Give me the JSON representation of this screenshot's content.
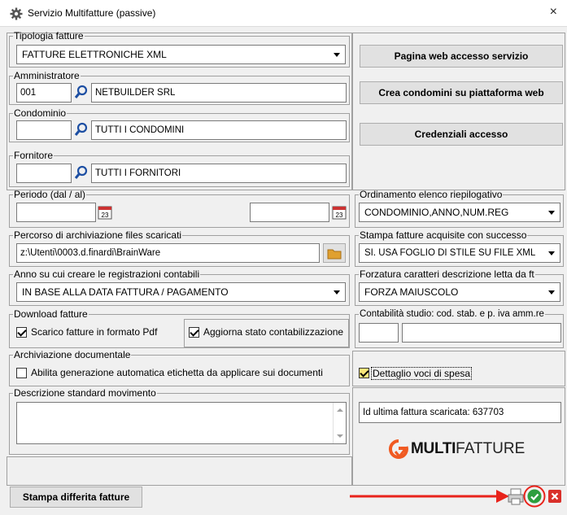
{
  "window": {
    "title": "Servizio Multifatture (passive)",
    "close": "×"
  },
  "tipologia": {
    "legend": "Tipologia fatture",
    "value": "FATTURE ELETTRONICHE XML"
  },
  "amministratore": {
    "legend": "Amministratore",
    "code": "001",
    "name": "NETBUILDER SRL"
  },
  "condominio": {
    "legend": "Condominio",
    "code": "",
    "name": "TUTTI I CONDOMINI"
  },
  "fornitore": {
    "legend": "Fornitore",
    "code": "",
    "name": "TUTTI I FORNITORI"
  },
  "buttons": {
    "pagina_web": "Pagina web accesso servizio",
    "crea_condomini": "Crea condomini su piattaforma web",
    "credenziali": "Credenziali accesso",
    "stampa_differita": "Stampa differita fatture"
  },
  "periodo": {
    "legend": "Periodo (dal / al)",
    "from": "",
    "to": "",
    "cal_label": "23"
  },
  "ordinamento": {
    "legend": "Ordinamento elenco riepilogativo",
    "value": "CONDOMINIO,ANNO,NUM.REG"
  },
  "percorso": {
    "legend": "Percorso di archiviazione files scaricati",
    "value": "z:\\Utenti\\0003.d.finardi\\BrainWare"
  },
  "stampa_fatture": {
    "legend": "Stampa fatture acquisite con successo",
    "value": "SI. USA FOGLIO DI STILE SU FILE XML"
  },
  "anno": {
    "legend": "Anno su cui creare le registrazioni contabili",
    "value": "IN BASE ALLA DATA FATTURA / PAGAMENTO"
  },
  "forzatura": {
    "legend": "Forzatura caratteri descrizione letta da ft",
    "value": "FORZA MAIUSCOLO"
  },
  "download": {
    "legend": "Download fatture",
    "pdf": "Scarico fatture in formato Pdf",
    "pdf_checked": true,
    "aggiorna": "Aggiorna stato contabilizzazione",
    "aggiorna_checked": true
  },
  "contabilita": {
    "legend": "Contabilità studio: cod. stab. e  p. iva amm.re",
    "cod": "",
    "piva": ""
  },
  "archiviazione": {
    "legend": "Archiviazione documentale",
    "label": "Abilita generazione automatica etichetta da applicare sui documenti",
    "checked": false
  },
  "dettaglio": {
    "label": "Dettaglio voci di spesa",
    "checked": true
  },
  "descrizione": {
    "legend": "Descrizione standard movimento",
    "value": ""
  },
  "ultima": {
    "text": "Id ultima fattura scaricata: 637703"
  },
  "logo": {
    "brand_bold": "MULTI",
    "brand_light": "FATTURE"
  },
  "colors": {
    "accent_orange": "#f05a22",
    "ok_green": "#2e9e3e",
    "cancel_red": "#d9302a",
    "annotation_red": "#e8231b"
  }
}
